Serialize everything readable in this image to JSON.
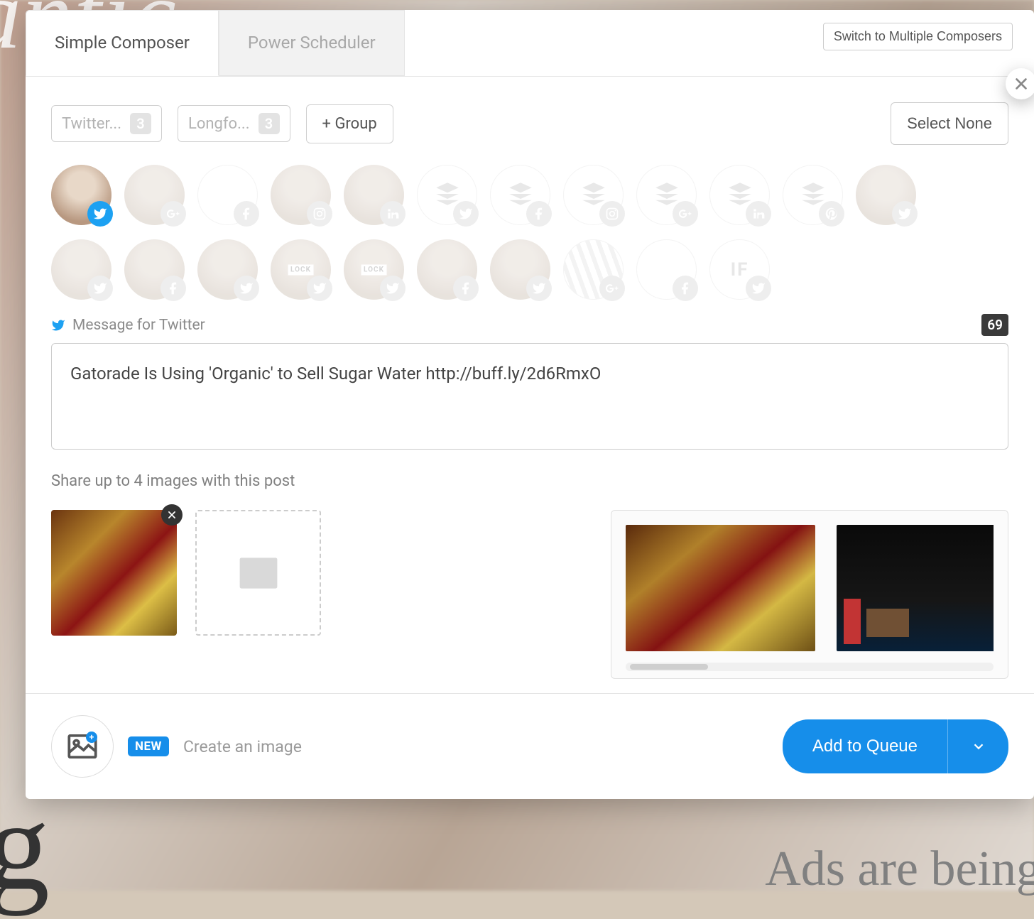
{
  "tabs": {
    "simple": "Simple Composer",
    "power": "Power Scheduler"
  },
  "switch_button": "Switch to Multiple Composers",
  "groups": [
    {
      "label": "Twitter...",
      "count": "3"
    },
    {
      "label": "Longfo...",
      "count": "3"
    }
  ],
  "add_group": "+ Group",
  "select_none": "Select None",
  "profiles_row1": [
    {
      "network": "twitter",
      "active": true,
      "kind": "face"
    },
    {
      "network": "googleplus",
      "active": false,
      "kind": "face"
    },
    {
      "network": "facebook",
      "active": false,
      "kind": "blank"
    },
    {
      "network": "instagram",
      "active": false,
      "kind": "face"
    },
    {
      "network": "linkedin",
      "active": false,
      "kind": "face"
    },
    {
      "network": "twitter",
      "active": false,
      "kind": "stack"
    },
    {
      "network": "facebook",
      "active": false,
      "kind": "stack"
    },
    {
      "network": "instagram",
      "active": false,
      "kind": "stack"
    },
    {
      "network": "googleplus",
      "active": false,
      "kind": "stack"
    },
    {
      "network": "linkedin",
      "active": false,
      "kind": "stack"
    },
    {
      "network": "pinterest",
      "active": false,
      "kind": "stack"
    },
    {
      "network": "twitter",
      "active": false,
      "kind": "face"
    }
  ],
  "profiles_row2": [
    {
      "network": "twitter",
      "active": false,
      "kind": "face"
    },
    {
      "network": "facebook",
      "active": false,
      "kind": "face"
    },
    {
      "network": "twitter",
      "active": false,
      "kind": "face"
    },
    {
      "network": "twitter",
      "active": false,
      "kind": "face-locked"
    },
    {
      "network": "twitter",
      "active": false,
      "kind": "face-locked"
    },
    {
      "network": "facebook",
      "active": false,
      "kind": "face"
    },
    {
      "network": "twitter",
      "active": false,
      "kind": "face"
    },
    {
      "network": "googleplus",
      "active": false,
      "kind": "stripes"
    },
    {
      "network": "facebook",
      "active": false,
      "kind": "blank"
    },
    {
      "network": "twitter",
      "active": false,
      "kind": "text"
    }
  ],
  "message_label": "Message for Twitter",
  "char_count": "69",
  "message_text": "Gatorade Is Using 'Organic' to Sell Sugar Water http://buff.ly/2d6RmxO",
  "share_hint": "Share up to 4 images with this post",
  "footer": {
    "new_badge": "NEW",
    "create_image": "Create an image",
    "queue_button": "Add to Queue"
  },
  "bg": {
    "top": "antic",
    "bottom_left": "g",
    "bottom_right": "Ads are being"
  }
}
